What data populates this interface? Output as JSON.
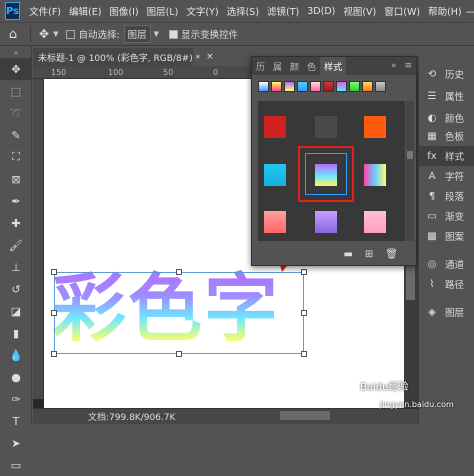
{
  "menubar": {
    "logo": "Ps",
    "items": [
      "文件(F)",
      "编辑(E)",
      "图像(I)",
      "图层(L)",
      "文字(Y)",
      "选择(S)",
      "滤镜(T)",
      "3D(D)",
      "视图(V)",
      "窗口(W)",
      "帮助(H)"
    ],
    "minimize": "—",
    "close": "✕"
  },
  "options": {
    "home": "⌂",
    "move": "✥",
    "auto_select_label": "自动选择:",
    "auto_select_value": "图层",
    "show_transform_label": "显示变换控件"
  },
  "document": {
    "tab_title": "未标题-1 @ 100% (彩色字, RGB/8#) *",
    "tab_close": "×",
    "ruler_numbers": [
      "150",
      "100",
      "50",
      "0",
      "50"
    ],
    "text_layer": "彩色字",
    "status": "文档:799.8K/906.7K"
  },
  "styles_panel": {
    "tabs": [
      "历",
      "属",
      "颜",
      "色",
      "样式"
    ],
    "active_tab": "样式",
    "menu_icon": "≡",
    "collapse": "»",
    "footer_icons": [
      "folder-icon",
      "new-style-icon",
      "delete-icon"
    ]
  },
  "dock": {
    "items": [
      {
        "icon": "⟲",
        "label": "历史"
      },
      {
        "icon": "☰",
        "label": "属性"
      },
      {
        "icon": "◐",
        "label": "颜色"
      },
      {
        "icon": "▦",
        "label": "色板"
      },
      {
        "icon": "fx",
        "label": "样式"
      },
      {
        "icon": "A",
        "label": "字符"
      },
      {
        "icon": "¶",
        "label": "段落"
      },
      {
        "icon": "▭",
        "label": "渐变"
      },
      {
        "icon": "▩",
        "label": "图案"
      },
      {
        "icon": "◎",
        "label": "通道"
      },
      {
        "icon": "⌇",
        "label": "路径"
      },
      {
        "icon": "◈",
        "label": "图层"
      }
    ]
  },
  "watermark": {
    "text": "Baidu经验",
    "url": "jingyan.baidu.com"
  }
}
